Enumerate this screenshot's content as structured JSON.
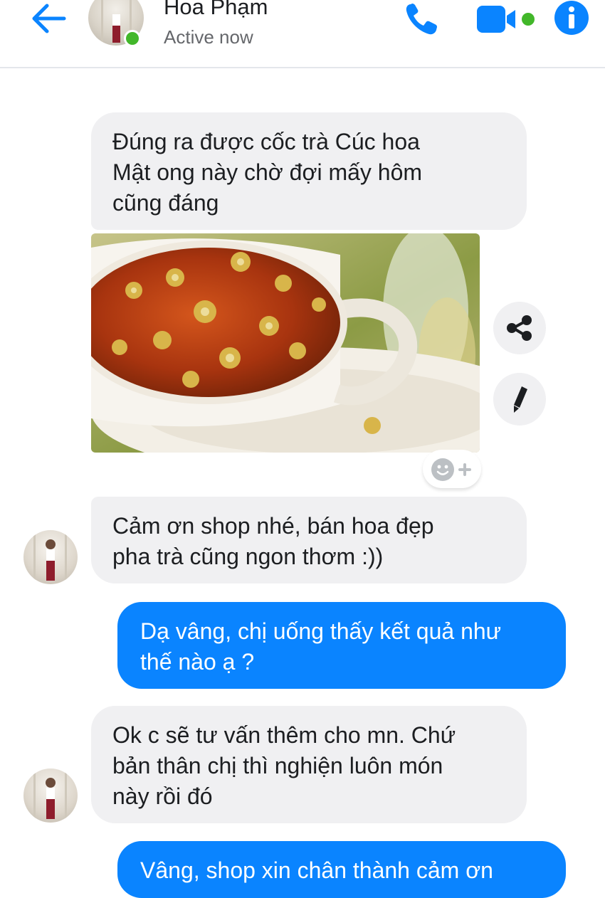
{
  "header": {
    "contact_name": "Hoa Phạm",
    "status": "Active now",
    "accent_color": "#0a84ff",
    "icons": [
      "back-arrow-icon",
      "phone-icon",
      "video-camera-icon",
      "info-icon"
    ]
  },
  "messages": [
    {
      "sender": "contact",
      "text": "Đúng ra được cốc trà Cúc hoa\nMật ong này chờ đợi mấy hôm\ncũng đáng"
    },
    {
      "sender": "contact",
      "type": "photo",
      "subject": "cup of chrysanthemum honey tea",
      "actions": [
        "share-icon",
        "edit-pencil-icon"
      ],
      "reaction_control": "add-reaction-icon"
    },
    {
      "sender": "contact",
      "text": "Cảm ơn shop nhé, bán hoa đẹp\npha trà cũng ngon thơm :))"
    },
    {
      "sender": "me",
      "text": "Dạ vâng, chị uống thấy kết quả như\nthế nào ạ ?"
    },
    {
      "sender": "contact",
      "text": "Ok c sẽ tư vấn thêm cho mn. Chứ\nbản thân chị thì nghiện luôn món\nnày rồi đó"
    },
    {
      "sender": "me",
      "text": "Vâng, shop xin chân thành cảm ơn"
    }
  ],
  "colors": {
    "incoming_bubble": "#f0f0f2",
    "outgoing_bubble": "#0a84ff",
    "online": "#42b72a"
  }
}
